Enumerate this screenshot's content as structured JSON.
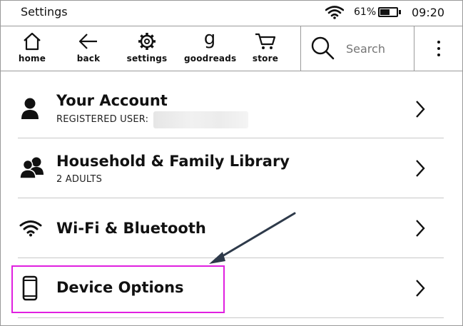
{
  "status_bar": {
    "title": "Settings",
    "battery_percent": "61%",
    "battery_level": 0.61,
    "time": "09:20"
  },
  "toolbar": {
    "home": "home",
    "back": "back",
    "settings": "settings",
    "goodreads": "goodreads",
    "goodreads_glyph": "g",
    "store": "store",
    "search_placeholder": "Search"
  },
  "settings_list": [
    {
      "title": "Your Account",
      "subtitle": "REGISTERED USER:",
      "icon": "person-icon"
    },
    {
      "title": "Household & Family Library",
      "subtitle": "2 ADULTS",
      "icon": "people-icon"
    },
    {
      "title": "Wi-Fi & Bluetooth",
      "subtitle": "",
      "icon": "wifi-icon"
    },
    {
      "title": "Device Options",
      "subtitle": "",
      "icon": "tablet-icon"
    }
  ],
  "annotation": {
    "highlight_color": "#e020e0",
    "arrow_color": "#2e3a4a"
  }
}
